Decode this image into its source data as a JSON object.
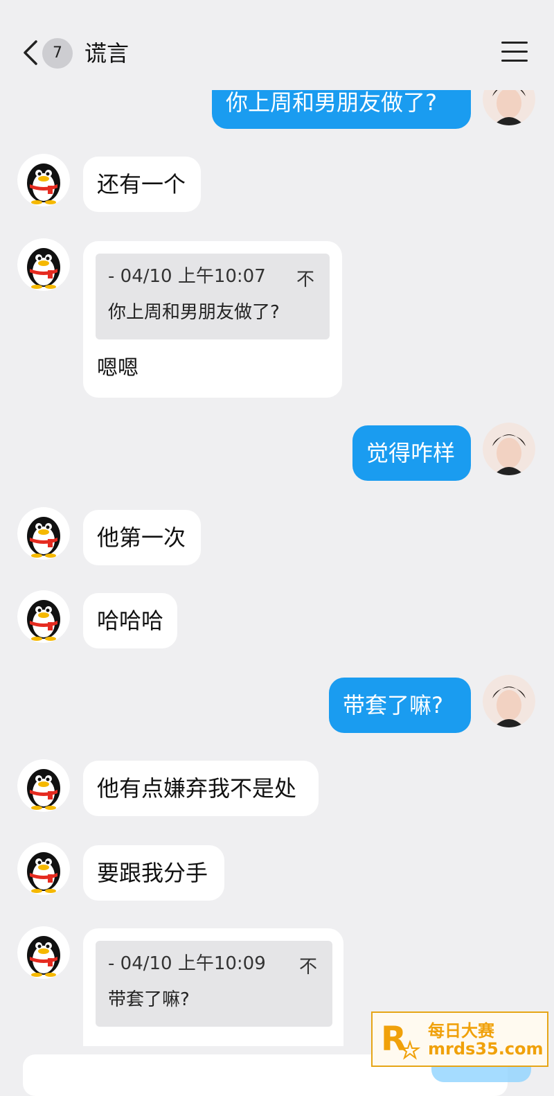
{
  "header": {
    "unread_count": "7",
    "title": "谎言"
  },
  "messages": [
    {
      "side": "out",
      "text": "你上周和男朋友做了?"
    },
    {
      "side": "in",
      "text": "还有一个"
    },
    {
      "side": "in",
      "quote": {
        "meta": "- 04/10 上午10:07",
        "pin": "不",
        "text": "你上周和男朋友做了?"
      },
      "text": "嗯嗯"
    },
    {
      "side": "out",
      "text": "觉得咋样"
    },
    {
      "side": "in",
      "text": "他第一次"
    },
    {
      "side": "in",
      "text": "哈哈哈"
    },
    {
      "side": "out",
      "text": "带套了嘛?"
    },
    {
      "side": "in",
      "text": "他有点嫌弃我不是处"
    },
    {
      "side": "in",
      "text": "要跟我分手"
    },
    {
      "side": "in",
      "quote": {
        "meta": "- 04/10 上午10:09",
        "pin": "不",
        "text": "带套了嘛?"
      },
      "text": ""
    }
  ],
  "watermark": {
    "title": "每日大赛",
    "url": "mrds35.com"
  },
  "colors": {
    "background": "#efeff1",
    "outgoing_bubble": "#1a9cf0",
    "incoming_bubble": "#ffffff"
  }
}
